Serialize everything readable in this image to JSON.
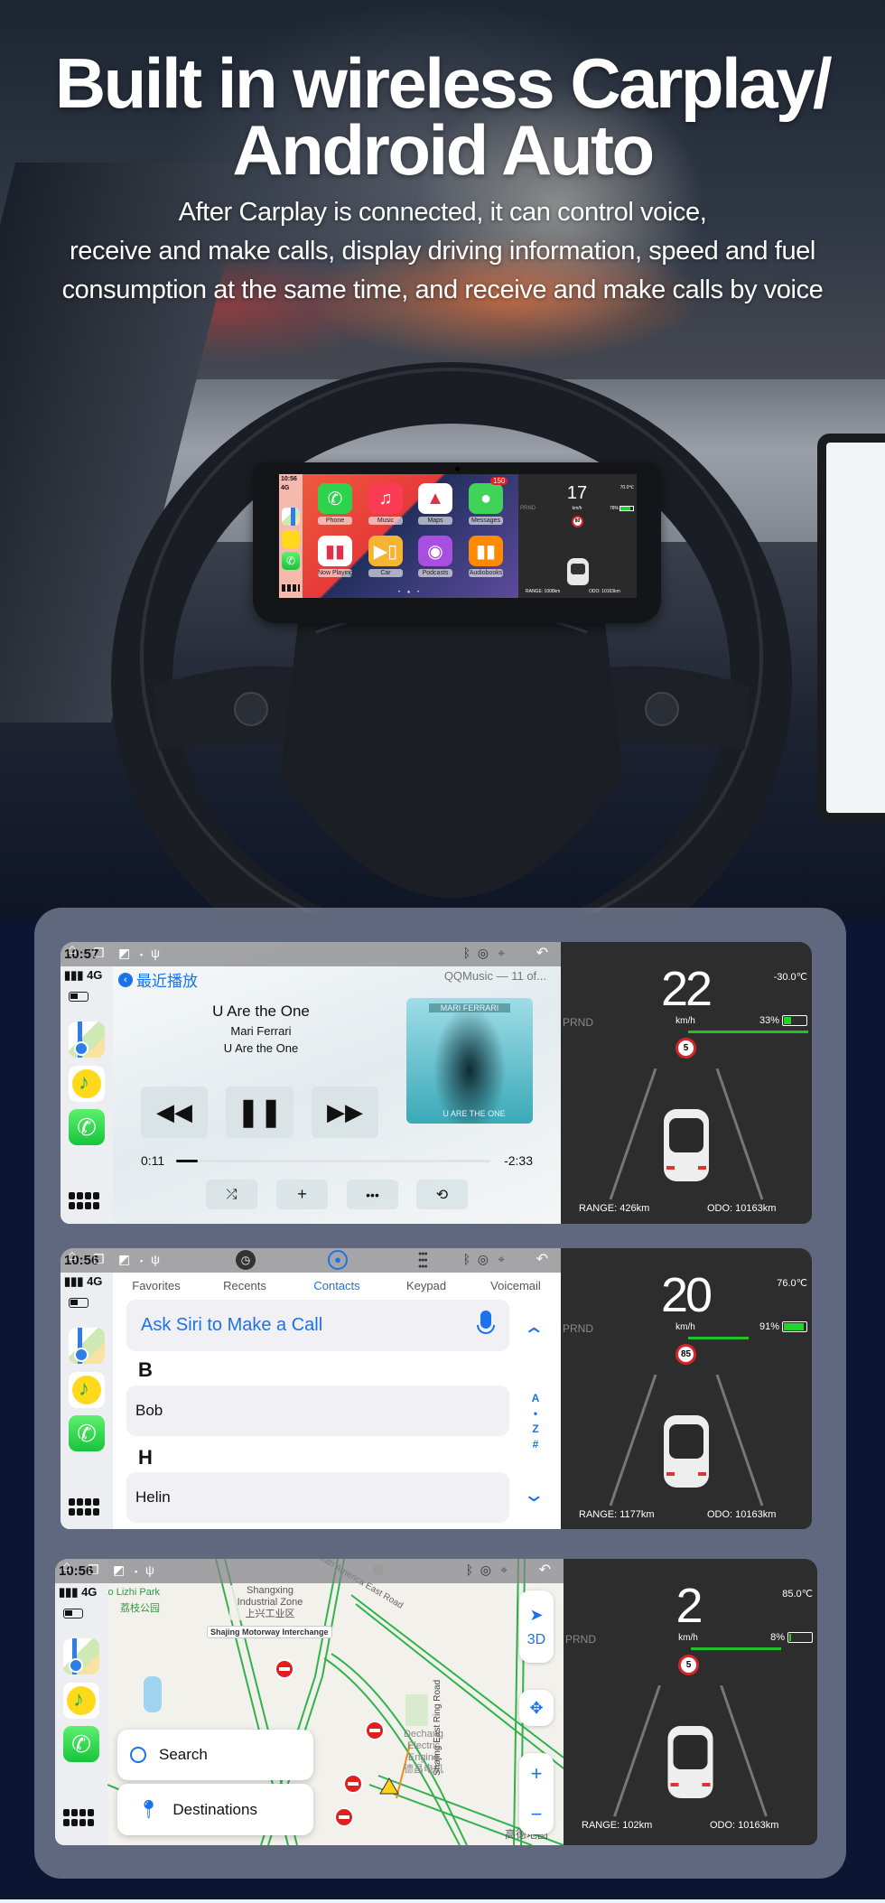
{
  "hero": {
    "title_line1": "Built in wireless Carplay/",
    "title_line2": "Android Auto",
    "subtitle": [
      "After Carplay is connected, it can control voice,",
      "receive and make calls, display driving information, speed and fuel",
      "consumption at the same time, and receive and make calls by voice"
    ]
  },
  "cluster_display": {
    "status": {
      "time": "10:56",
      "network": "4G"
    },
    "messages_badge": "150",
    "apps": [
      {
        "label": "Phone",
        "icon": "phone-icon",
        "color": "#2fd24d"
      },
      {
        "label": "Music",
        "icon": "music-icon",
        "color": "#fa3c55"
      },
      {
        "label": "Maps",
        "icon": "maps-icon",
        "color": "#ffffff"
      },
      {
        "label": "Messages",
        "icon": "messages-icon",
        "color": "#3fd358"
      },
      {
        "label": "Now Playing",
        "icon": "now-playing-icon",
        "color": "#ffffff"
      },
      {
        "label": "Car",
        "icon": "car-icon",
        "color": "#f6b531"
      },
      {
        "label": "Podcasts",
        "icon": "podcasts-icon",
        "color": "#a84ee0"
      },
      {
        "label": "Audiobooks",
        "icon": "audiobooks-icon",
        "color": "#ff8a00"
      }
    ],
    "dashboard": {
      "speed": "17",
      "unit": "km/h",
      "temp": "70.0℃",
      "battery": "78%",
      "battery_level": 0.78,
      "speed_limit": "80",
      "gear": "PRND",
      "range": "RANGE: 1008km",
      "odo": "ODO: 10163km"
    }
  },
  "screens": [
    {
      "status": {
        "time": "10:57",
        "network": "4G"
      },
      "music": {
        "back_label": "最近播放",
        "source": "QQMusic — 11 of...",
        "song": "U Are the One",
        "artist": "Mari Ferrari",
        "album": "U Are the One",
        "album_art_text_top": "MARI FERRARI",
        "album_art_text_bottom": "U ARE THE ONE",
        "elapsed": "0:11",
        "remaining": "-2:33",
        "progress": 0.07
      },
      "dashboard": {
        "speed": "22",
        "unit": "km/h",
        "temp": "-30.0℃",
        "battery": "33%",
        "battery_level": 0.33,
        "power_level": 1.0,
        "speed_limit": "5",
        "gear": "PRND",
        "range": "RANGE: 426km",
        "odo": "ODO: 10163km"
      }
    },
    {
      "status": {
        "time": "10:56",
        "network": "4G"
      },
      "phone": {
        "tabs": [
          "Favorites",
          "Recents",
          "Contacts",
          "Keypad",
          "Voicemail"
        ],
        "active_tab": "Contacts",
        "siri_label": "Ask Siri to Make a Call",
        "sections": [
          {
            "letter": "B",
            "contacts": [
              "Bob"
            ]
          },
          {
            "letter": "H",
            "contacts": [
              "Helin"
            ]
          }
        ],
        "index": [
          "A",
          "•",
          "Z",
          "#"
        ]
      },
      "dashboard": {
        "speed": "20",
        "unit": "km/h",
        "temp": "76.0℃",
        "battery": "91%",
        "battery_level": 0.91,
        "power_level": 0.5,
        "speed_limit": "85",
        "gear": "PRND",
        "range": "RANGE: 1177km",
        "odo": "ODO: 10163km"
      }
    },
    {
      "status": {
        "time": "10:56",
        "network": "4G"
      },
      "map": {
        "search_label": "Search",
        "destinations_label": "Destinations",
        "mode_3d": "3D",
        "labels": {
          "industrial_zone": "Shangxing Industrial Zone",
          "industrial_zone_cn": "上兴工业区",
          "interchange": "Shajing Motorway Interchange",
          "road_east": "South America East Road",
          "park": "Jiangliao Lizhi Park",
          "park_cn": "荔枝公园",
          "poi": "Dechang Electric Engine",
          "poi_cn": "德昌电机",
          "ring_road": "Shajing East Ring Road",
          "provider": "高德地图"
        }
      },
      "dashboard": {
        "speed": "2",
        "unit": "km/h",
        "temp": "85.0℃",
        "battery": "8%",
        "battery_level": 0.08,
        "power_level": 0.75,
        "speed_limit": "5",
        "gear": "PRND",
        "range": "RANGE: 102km",
        "odo": "ODO: 10163km"
      }
    }
  ]
}
